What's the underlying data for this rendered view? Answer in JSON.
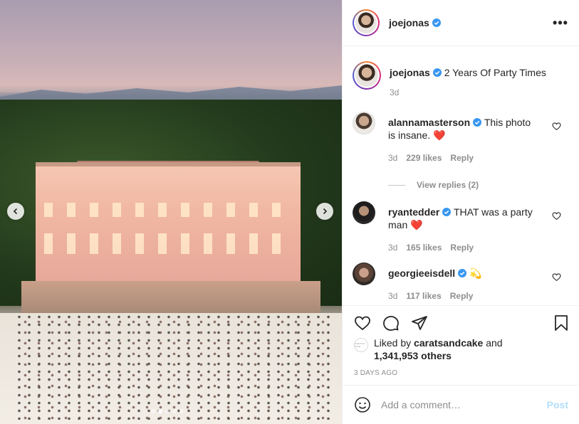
{
  "post": {
    "author": "joejonas",
    "more_icon": "•••",
    "caption": "2 Years Of Party Times",
    "caption_age": "3d",
    "image_alt": "castle party"
  },
  "comments": [
    {
      "user": "alannamasterson",
      "text": "This photo is insane. ❤️",
      "age": "3d",
      "likes": "229 likes",
      "reply": "Reply",
      "view_replies": "View replies (2)"
    },
    {
      "user": "ryantedder",
      "text": "THAT was a party man ❤️",
      "age": "3d",
      "likes": "165 likes",
      "reply": "Reply"
    },
    {
      "user": "georgieeisdell",
      "text": "💫",
      "age": "3d",
      "likes": "117 likes",
      "reply": "Reply"
    }
  ],
  "likes": {
    "prefix": "Liked by",
    "user": "caratsandcake",
    "connector": "and",
    "others": "1,341,953 others",
    "liker_avatar_text": "CARATS & CAKE"
  },
  "date": "3 DAYS AGO",
  "add_comment": {
    "placeholder": "Add a comment…",
    "post_label": "Post"
  },
  "carousel": {
    "slide_count": 5,
    "active_index": 1
  },
  "colors": {
    "verified": "#3897f0",
    "heart": "#ed4956",
    "post_disabled": "#b2dffc",
    "muted": "#8e8e8e"
  }
}
